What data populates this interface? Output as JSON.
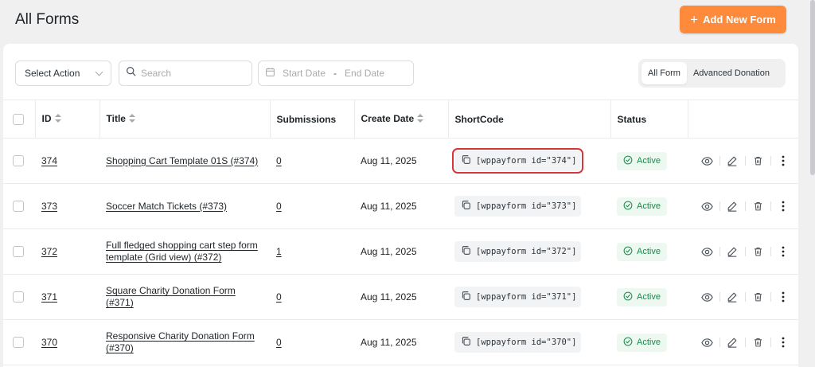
{
  "header": {
    "title": "All Forms",
    "add_button_label": "Add New Form"
  },
  "toolbar": {
    "select_action_label": "Select Action",
    "search_placeholder": "Search",
    "start_date_placeholder": "Start Date",
    "date_separator": "-",
    "end_date_placeholder": "End Date",
    "filter_tabs": [
      "All Form",
      "Advanced Donation"
    ],
    "active_filter": "All Form"
  },
  "table": {
    "columns": [
      "ID",
      "Title",
      "Submissions",
      "Create Date",
      "ShortCode",
      "Status"
    ],
    "rows": [
      {
        "id": "374",
        "title": "Shopping Cart Template 01S (#374)",
        "submissions": "0",
        "date": "Aug 11, 2025",
        "shortcode": "[wppayform id=\"374\"]",
        "status": "Active",
        "highlighted": true
      },
      {
        "id": "373",
        "title": "Soccer Match Tickets (#373)",
        "submissions": "0",
        "date": "Aug 11, 2025",
        "shortcode": "[wppayform id=\"373\"]",
        "status": "Active",
        "highlighted": false
      },
      {
        "id": "372",
        "title": "Full fledged shopping cart step form template (Grid view) (#372)",
        "submissions": "1",
        "date": "Aug 11, 2025",
        "shortcode": "[wppayform id=\"372\"]",
        "status": "Active",
        "highlighted": false
      },
      {
        "id": "371",
        "title": "Square Charity Donation Form (#371)",
        "submissions": "0",
        "date": "Aug 11, 2025",
        "shortcode": "[wppayform id=\"371\"]",
        "status": "Active",
        "highlighted": false
      },
      {
        "id": "370",
        "title": "Responsive Charity Donation Form (#370)",
        "submissions": "0",
        "date": "Aug 11, 2025",
        "shortcode": "[wppayform id=\"370\"]",
        "status": "Active",
        "highlighted": false
      }
    ]
  },
  "colors": {
    "accent": "#fd8b3b",
    "active_status": "#1e8a4c",
    "highlight_outline": "#d63638"
  },
  "icons": [
    "plus-icon",
    "chevron-down-icon",
    "search-icon",
    "calendar-icon",
    "sort-icon",
    "copy-icon",
    "check-circle-icon",
    "eye-icon",
    "edit-icon",
    "trash-icon",
    "more-vertical-icon"
  ]
}
